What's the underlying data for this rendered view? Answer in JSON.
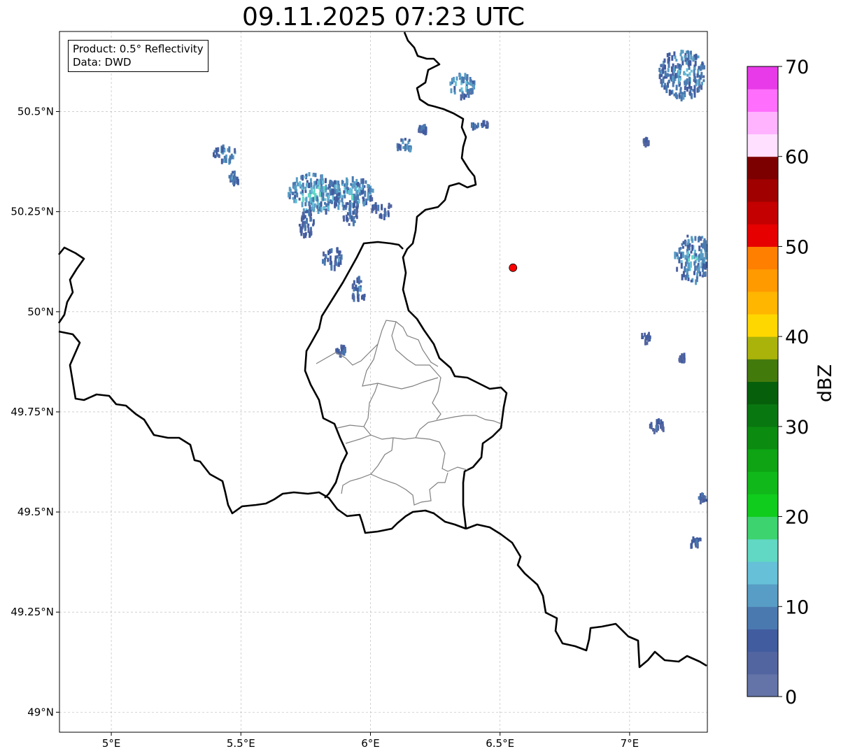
{
  "title": "09.11.2025 07:23 UTC",
  "info": {
    "product": "Product: 0.5° Reflectivity",
    "source": "Data: DWD"
  },
  "map": {
    "lon_range": [
      4.8,
      7.3
    ],
    "lat_range": [
      48.95,
      50.7
    ],
    "lon_ticks": [
      {
        "value": 5.0,
        "label": "5°E"
      },
      {
        "value": 5.5,
        "label": "5.5°E"
      },
      {
        "value": 6.0,
        "label": "6°E"
      },
      {
        "value": 6.5,
        "label": "6.5°E"
      },
      {
        "value": 7.0,
        "label": "7°E"
      }
    ],
    "lat_ticks": [
      {
        "value": 49.0,
        "label": "49°N"
      },
      {
        "value": 49.25,
        "label": "49.25°N"
      },
      {
        "value": 49.5,
        "label": "49.5°N"
      },
      {
        "value": 49.75,
        "label": "49.75°N"
      },
      {
        "value": 50.0,
        "label": "50°N"
      },
      {
        "value": 50.25,
        "label": "50.25°N"
      },
      {
        "value": 50.5,
        "label": "50.5°N"
      }
    ],
    "radar_site": {
      "lon": 6.55,
      "lat": 50.11,
      "color": "#ff0000"
    },
    "echo_cells": [
      {
        "lon": 5.44,
        "lat": 50.4,
        "rlon": 0.05,
        "rlat": 0.02,
        "dbz": 12
      },
      {
        "lon": 5.47,
        "lat": 50.34,
        "rlon": 0.02,
        "rlat": 0.015,
        "dbz": 10
      },
      {
        "lon": 5.78,
        "lat": 50.3,
        "rlon": 0.1,
        "rlat": 0.05,
        "dbz": 14
      },
      {
        "lon": 5.92,
        "lat": 50.3,
        "rlon": 0.09,
        "rlat": 0.04,
        "dbz": 13
      },
      {
        "lon": 5.75,
        "lat": 50.23,
        "rlon": 0.03,
        "rlat": 0.04,
        "dbz": 8
      },
      {
        "lon": 5.92,
        "lat": 50.25,
        "rlon": 0.03,
        "rlat": 0.03,
        "dbz": 9
      },
      {
        "lon": 6.04,
        "lat": 50.26,
        "rlon": 0.04,
        "rlat": 0.02,
        "dbz": 8
      },
      {
        "lon": 5.85,
        "lat": 50.14,
        "rlon": 0.04,
        "rlat": 0.025,
        "dbz": 11
      },
      {
        "lon": 5.95,
        "lat": 50.06,
        "rlon": 0.03,
        "rlat": 0.03,
        "dbz": 10
      },
      {
        "lon": 6.13,
        "lat": 50.42,
        "rlon": 0.03,
        "rlat": 0.015,
        "dbz": 11
      },
      {
        "lon": 6.2,
        "lat": 50.46,
        "rlon": 0.02,
        "rlat": 0.01,
        "dbz": 9
      },
      {
        "lon": 6.35,
        "lat": 50.57,
        "rlon": 0.05,
        "rlat": 0.03,
        "dbz": 12
      },
      {
        "lon": 6.42,
        "lat": 50.47,
        "rlon": 0.04,
        "rlat": 0.01,
        "dbz": 9
      },
      {
        "lon": 5.88,
        "lat": 49.91,
        "rlon": 0.02,
        "rlat": 0.01,
        "dbz": 8
      },
      {
        "lon": 7.2,
        "lat": 50.6,
        "rlon": 0.09,
        "rlat": 0.06,
        "dbz": 12
      },
      {
        "lon": 7.24,
        "lat": 50.14,
        "rlon": 0.07,
        "rlat": 0.06,
        "dbz": 13
      },
      {
        "lon": 7.1,
        "lat": 49.72,
        "rlon": 0.03,
        "rlat": 0.015,
        "dbz": 8
      },
      {
        "lon": 7.06,
        "lat": 49.94,
        "rlon": 0.02,
        "rlat": 0.015,
        "dbz": 8
      },
      {
        "lon": 7.25,
        "lat": 49.43,
        "rlon": 0.03,
        "rlat": 0.01,
        "dbz": 7
      },
      {
        "lon": 7.28,
        "lat": 49.54,
        "rlon": 0.02,
        "rlat": 0.01,
        "dbz": 9
      },
      {
        "lon": 7.2,
        "lat": 49.89,
        "rlon": 0.015,
        "rlat": 0.01,
        "dbz": 7
      },
      {
        "lon": 7.06,
        "lat": 50.43,
        "rlon": 0.01,
        "rlat": 0.008,
        "dbz": 7
      }
    ]
  },
  "colorbar": {
    "label": "dBZ",
    "min": 0,
    "max": 70,
    "ticks": [
      {
        "value": 0,
        "label": "0"
      },
      {
        "value": 10,
        "label": "10"
      },
      {
        "value": 20,
        "label": "20"
      },
      {
        "value": 30,
        "label": "30"
      },
      {
        "value": 40,
        "label": "40"
      },
      {
        "value": 50,
        "label": "50"
      },
      {
        "value": 60,
        "label": "60"
      },
      {
        "value": 70,
        "label": "70"
      }
    ],
    "colors": [
      "#6474a8",
      "#5365a0",
      "#415c9f",
      "#4a79b0",
      "#589dc5",
      "#65c0d8",
      "#60d8c3",
      "#3dd36f",
      "#10cc1c",
      "#10b919",
      "#0ea414",
      "#0b8c10",
      "#097710",
      "#06600b",
      "#437a0c",
      "#aab30a",
      "#ffd700",
      "#ffb600",
      "#ff9a00",
      "#ff7f00",
      "#e60000",
      "#c40000",
      "#a00000",
      "#7d0000",
      "#ffe0ff",
      "#ffb3ff",
      "#ff6efc",
      "#e83ae8"
    ]
  }
}
